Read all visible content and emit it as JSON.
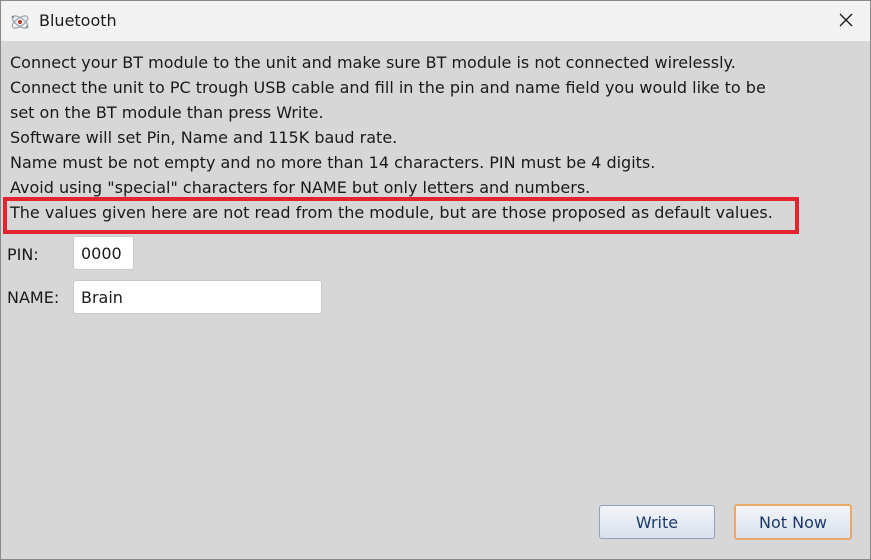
{
  "window": {
    "title": "Bluetooth",
    "app_icon": "bluetooth-app-icon",
    "close_icon": "close-icon"
  },
  "instructions": {
    "lines": [
      "Connect your BT module to the unit and make sure BT module is not connected wirelessly.",
      "Connect the unit to PC trough USB cable and fill in the pin and name field you would like to be",
      "set on the BT module than press Write.",
      "Software will set Pin, Name and 115K baud rate.",
      "Name must be not empty and no more than 14 characters. PIN must be 4 digits.",
      "Avoid using \"special\" characters for NAME but only letters and numbers.",
      "The values given here are not read from the module, but are those proposed as default values."
    ]
  },
  "form": {
    "pin_label": "PIN:",
    "pin_value": "0000",
    "name_label": "NAME:",
    "name_value": "Brain"
  },
  "buttons": {
    "write_label": "Write",
    "not_now_label": "Not Now"
  },
  "colors": {
    "highlight": "#e3232d",
    "dialog_background": "#d7d7d7",
    "default_button_border": "#e9a86a"
  }
}
